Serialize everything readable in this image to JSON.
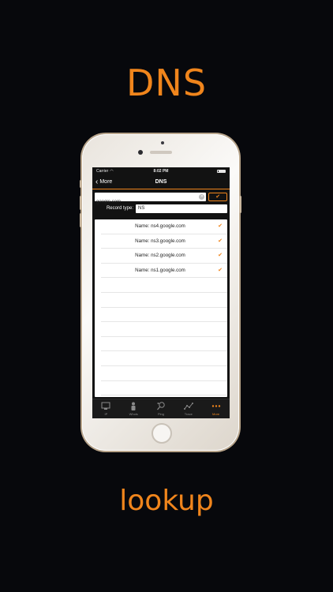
{
  "marketing": {
    "headline_top": "DNS",
    "headline_bottom": "lookup"
  },
  "colors": {
    "accent": "#f0851c",
    "background": "#07080c",
    "screen": "#121212"
  },
  "status_bar": {
    "carrier": "Carrier",
    "time": "8:02 PM"
  },
  "nav": {
    "back_label": "More",
    "title": "DNS"
  },
  "form": {
    "host_value": "google.com",
    "record_type_label": "Record type:",
    "record_type_value": "NS"
  },
  "results": [
    {
      "text": "Name: ns4.google.com"
    },
    {
      "text": "Name: ns3.google.com"
    },
    {
      "text": "Name: ns2.google.com"
    },
    {
      "text": "Name: ns1.google.com"
    }
  ],
  "tabs": [
    {
      "label": "IP",
      "icon": "monitor-icon",
      "active": false
    },
    {
      "label": "Whois",
      "icon": "person-icon",
      "active": false
    },
    {
      "label": "Ping",
      "icon": "ping-pong-icon",
      "active": false
    },
    {
      "label": "Trace",
      "icon": "trace-route-icon",
      "active": false
    },
    {
      "label": "More",
      "icon": "more-dots-icon",
      "active": true
    }
  ]
}
